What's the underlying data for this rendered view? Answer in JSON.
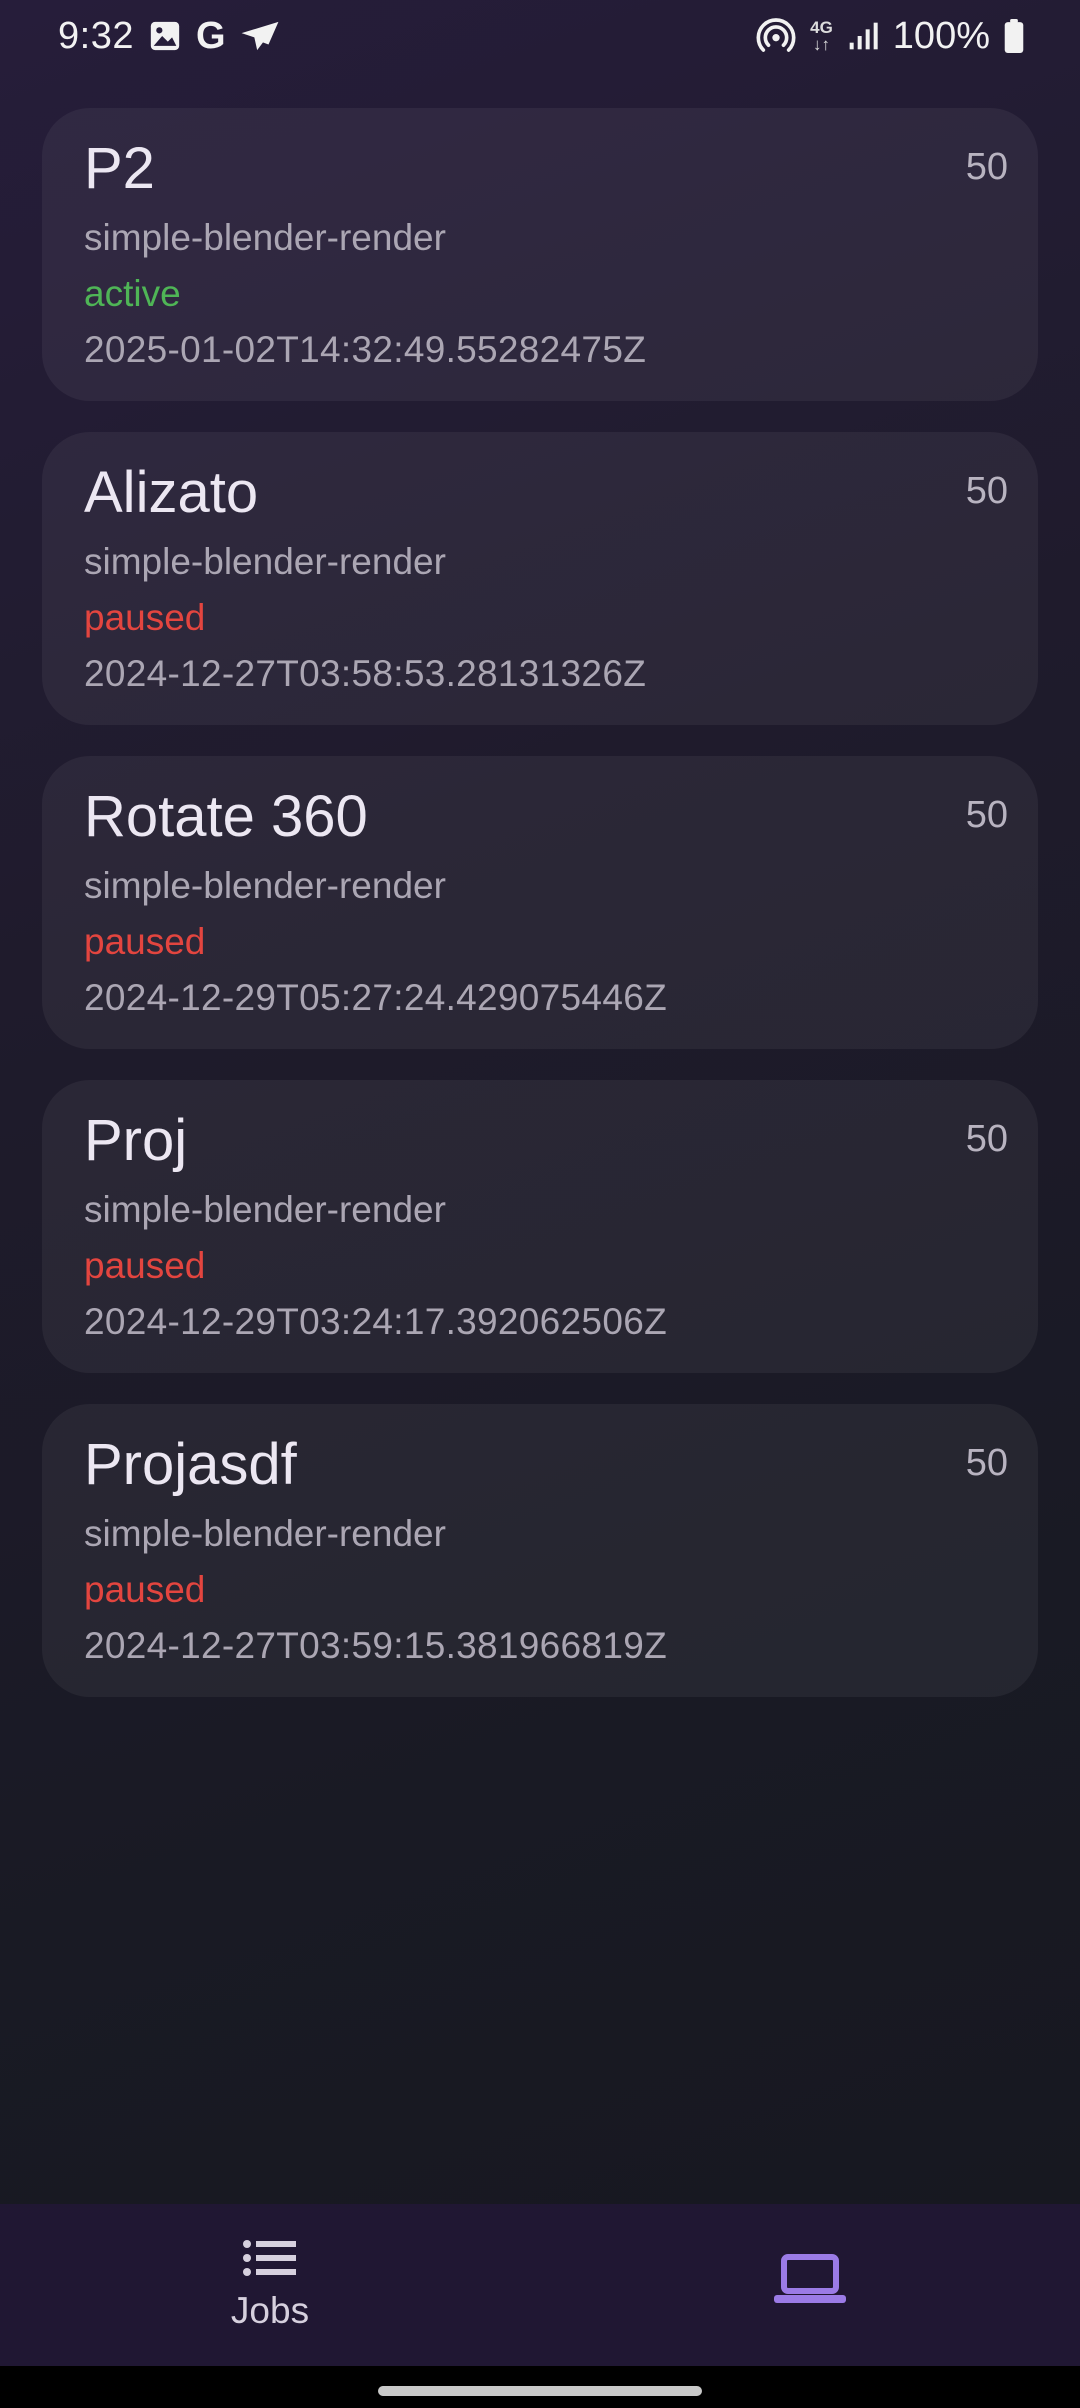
{
  "status_bar": {
    "time": "9:32",
    "google_glyph": "G",
    "network_type": "4G",
    "battery": "100%",
    "icons": [
      "image-icon",
      "google-icon",
      "send-icon",
      "hotspot-icon",
      "network-4g-icon",
      "signal-icon",
      "battery-icon"
    ]
  },
  "jobs": [
    {
      "title": "P2",
      "priority": "50",
      "type": "simple-blender-render",
      "status": "active",
      "date": "2025-01-02T14:32:49.55282475Z"
    },
    {
      "title": "Alizato",
      "priority": "50",
      "type": "simple-blender-render",
      "status": "paused",
      "date": "2024-12-27T03:58:53.28131326Z"
    },
    {
      "title": "Rotate 360",
      "priority": "50",
      "type": "simple-blender-render",
      "status": "paused",
      "date": "2024-12-29T05:27:24.429075446Z"
    },
    {
      "title": "Proj",
      "priority": "50",
      "type": "simple-blender-render",
      "status": "paused",
      "date": "2024-12-29T03:24:17.392062506Z"
    },
    {
      "title": "Projasdf",
      "priority": "50",
      "type": "simple-blender-render",
      "status": "paused",
      "date": "2024-12-27T03:59:15.381966819Z"
    }
  ],
  "colors": {
    "status_active": "#4fb556",
    "status_paused": "#e3453f",
    "nav_accent": "#9b7be6",
    "nav_background": "#201733"
  },
  "bottom_nav": {
    "items": [
      {
        "label": "Jobs",
        "icon": "list-icon"
      },
      {
        "label": "",
        "icon": "laptop-icon"
      }
    ]
  }
}
